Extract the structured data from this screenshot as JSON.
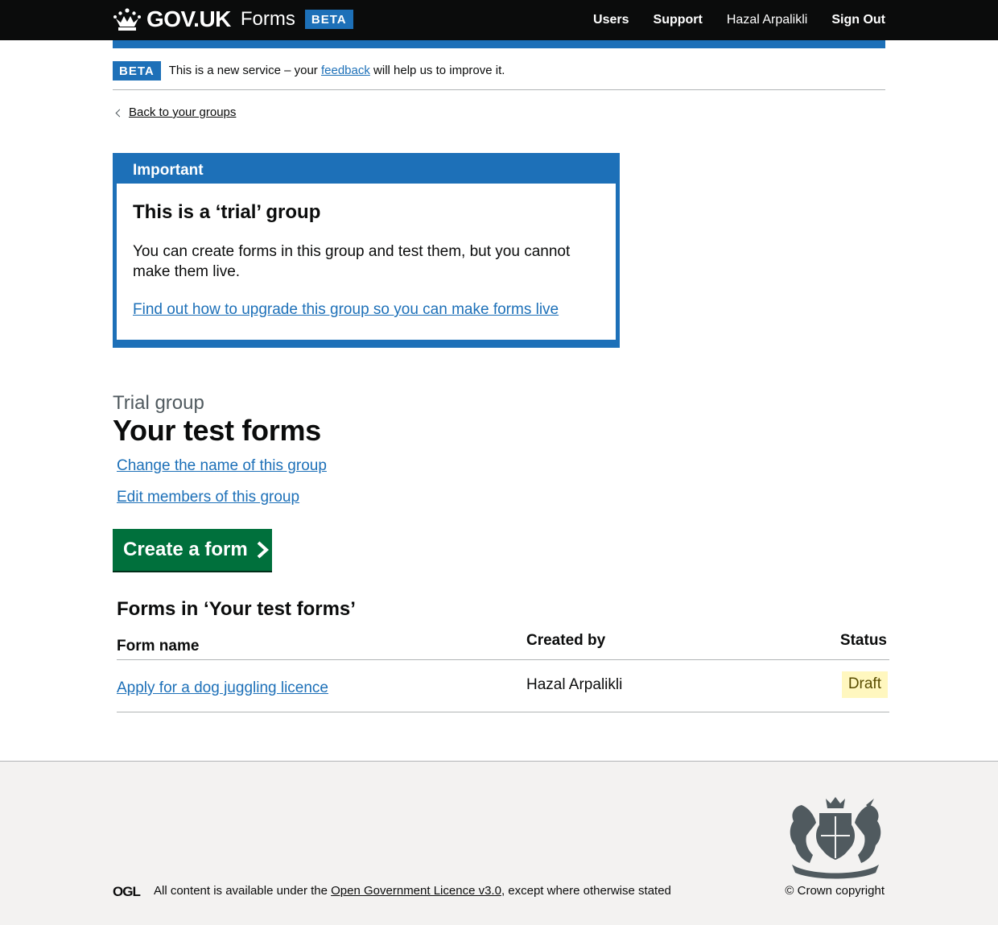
{
  "header": {
    "logo_text": "GOV.UK",
    "service_name": "Forms",
    "phase": "BETA",
    "nav": {
      "users": "Users",
      "support": "Support",
      "user_name": "Hazal Arpalikli",
      "sign_out": "Sign Out"
    }
  },
  "phase_banner": {
    "tag": "BETA",
    "text_before": "This is a new service – your ",
    "feedback_link": "feedback",
    "text_after": " will help us to improve it."
  },
  "back_link": "Back to your groups",
  "notification": {
    "title": "Important",
    "heading": "This is a ‘trial’ group",
    "body": "You can create forms in this group and test them, but you cannot make them live.",
    "link": "Find out how to upgrade this group so you can make forms live"
  },
  "page": {
    "caption": "Trial group",
    "title": "Your test forms",
    "rename_link": "Change the name of this group",
    "members_link": "Edit members of this group",
    "create_button": "Create a form"
  },
  "table": {
    "caption": "Forms in ‘Your test forms’",
    "headers": {
      "name": "Form name",
      "created_by": "Created by",
      "status": "Status"
    },
    "rows": [
      {
        "name": "Apply for a dog juggling licence",
        "created_by": "Hazal Arpalikli",
        "status": "Draft"
      }
    ]
  },
  "footer": {
    "licence_before": "All content is available under the ",
    "licence_link": "Open Government Licence v3.0",
    "licence_after": ", except where otherwise stated",
    "copyright": "© Crown copyright",
    "ogl_logo": "OGL"
  },
  "colors": {
    "header_bg": "#0b0c0c",
    "brand_blue": "#1d70b8",
    "button_green": "#00703c",
    "draft_tag_bg": "#fff7bf",
    "draft_tag_text": "#594d00",
    "footer_bg": "#f3f2f1"
  },
  "icons": {
    "logo": "crown-icon",
    "back": "chevron-left-icon",
    "button": "chevron-right-icon",
    "footer_logo": "royal-coat-of-arms-icon"
  }
}
